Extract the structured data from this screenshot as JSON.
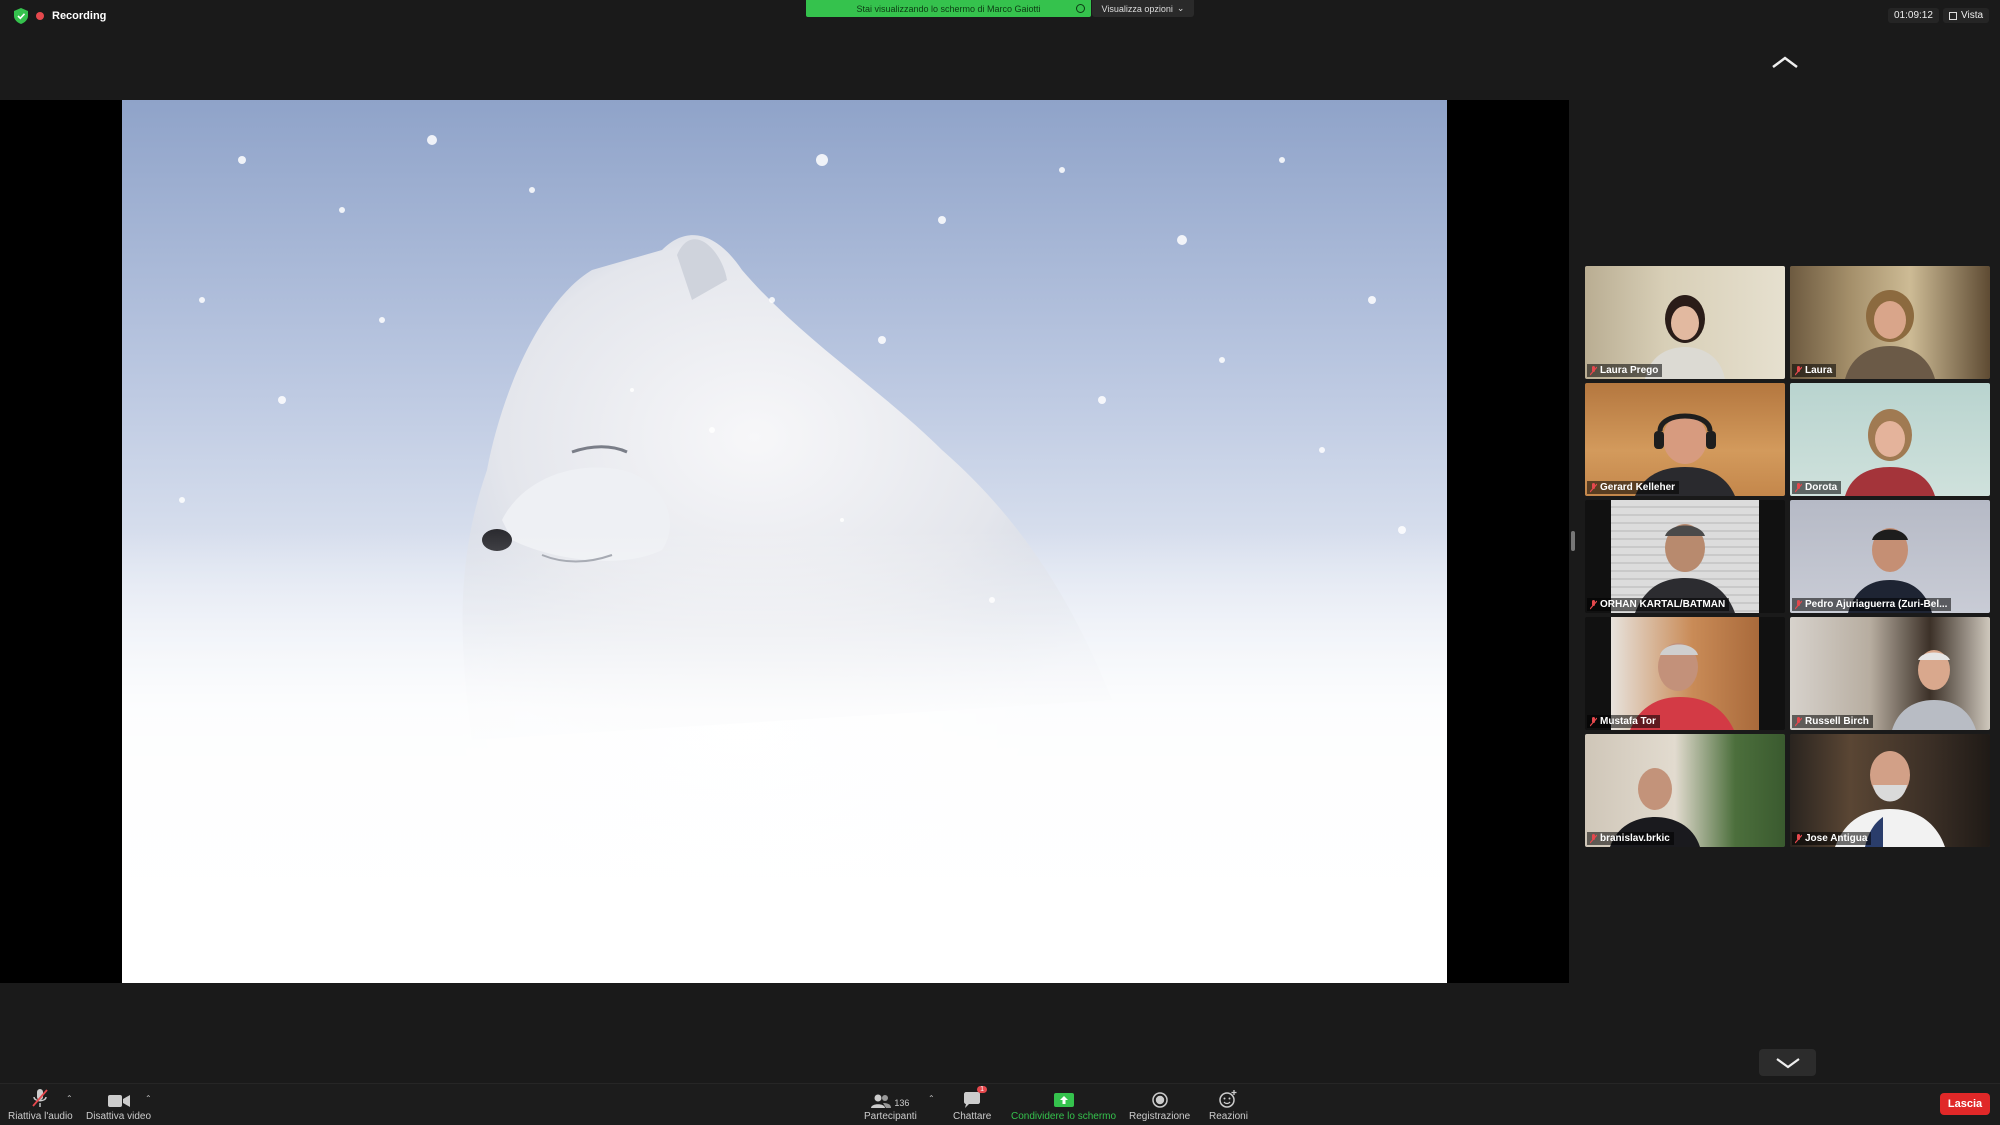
{
  "recording": {
    "label": "Recording"
  },
  "banner": {
    "sharing_text": "Stai visualizzando lo schermo di Marco Gaiotti",
    "view_options": "Visualizza opzioni"
  },
  "header": {
    "time": "01:09:12",
    "view_label": "Vista"
  },
  "participants": [
    {
      "name": "Laura Prego",
      "muted": true
    },
    {
      "name": "Laura",
      "muted": true
    },
    {
      "name": "Gerard Kelleher",
      "muted": true
    },
    {
      "name": "Dorota",
      "muted": true
    },
    {
      "name": "ORHAN KARTAL/BATMAN",
      "muted": true
    },
    {
      "name": "Pedro Ajuriaguerra (Zuri-Bel...",
      "muted": true
    },
    {
      "name": "Mustafa Tor",
      "muted": true
    },
    {
      "name": "Russell Birch",
      "muted": true
    },
    {
      "name": "branislav.brkic",
      "muted": true
    },
    {
      "name": "Jose Antigua",
      "muted": true
    }
  ],
  "toolbar": {
    "unmute": "Riattiva l'audio",
    "video": "Disattiva video",
    "participants": "Partecipanti",
    "participants_count": "136",
    "chat": "Chattare",
    "chat_badge": "1",
    "share": "Condividere lo schermo",
    "record": "Registrazione",
    "reactions": "Reazioni",
    "leave": "Lascia"
  },
  "colors": {
    "green": "#35c24d",
    "red": "#e02828",
    "background": "#1a1a1a"
  }
}
